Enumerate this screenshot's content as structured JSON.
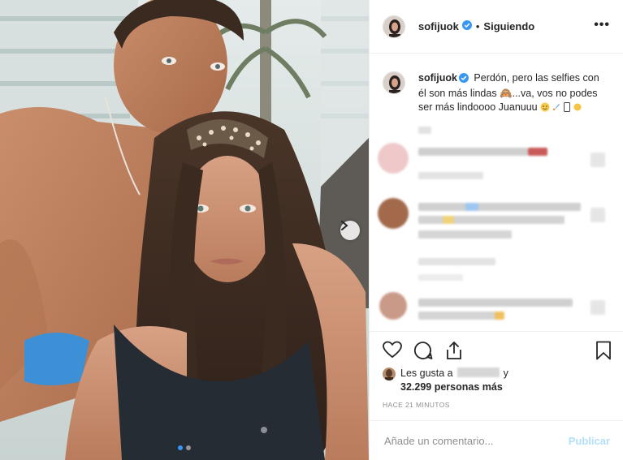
{
  "post": {
    "username": "sofijuok",
    "follow_state": "Siguiendo",
    "separator": "•",
    "more_icon": "•••",
    "caption": {
      "username": "sofijuok",
      "text": "Perdón, pero las selfies con él son más lindas 🙈...va, vos no podes ser más lindoooo Juanuuu"
    },
    "likes": {
      "prefix": "Les gusta a",
      "connector": "y",
      "count_text": "32.299 personas más"
    },
    "timestamp": "HACE 21 MINUTOS",
    "comment_placeholder": "Añade un comentario...",
    "publish_label": "Publicar"
  },
  "icons": {
    "verified": "verified-badge-icon",
    "like": "heart-icon",
    "comment": "comment-bubble-icon",
    "share": "share-icon",
    "save": "bookmark-icon",
    "next": "chevron-right-icon",
    "more": "more-options-icon"
  },
  "carousel": {
    "total": 2,
    "current": 1
  },
  "colors": {
    "verified": "#3897f0",
    "publish_disabled": "#b2dffc",
    "timestamp": "#8e8e8e",
    "border": "#efefef"
  }
}
